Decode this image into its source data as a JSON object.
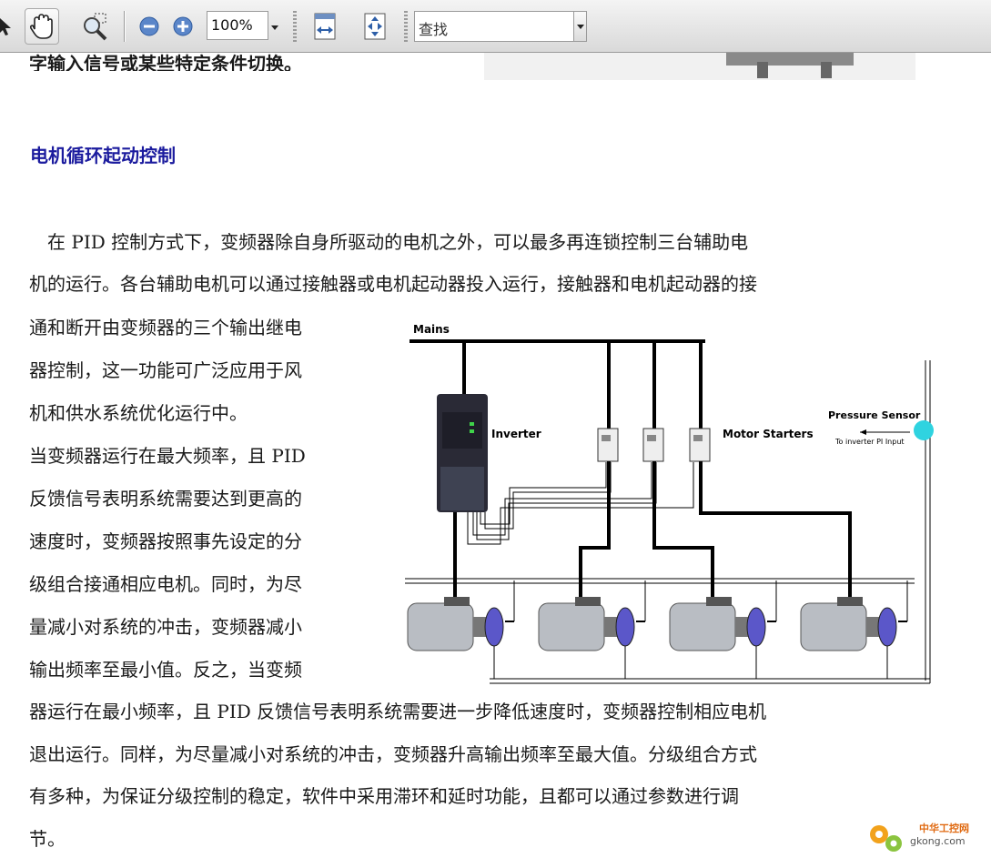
{
  "toolbar": {
    "zoom_value": "100%",
    "find_placeholder": "查找",
    "icons": [
      "select-arrow-icon",
      "hand-icon",
      "zoom-marquee-icon",
      "zoom-out-icon",
      "zoom-in-icon",
      "fit-width-icon",
      "fit-page-icon"
    ]
  },
  "document": {
    "cut_top_line": "字输入信号或某些特定条件切换。",
    "section_heading": "电机循环起动控制",
    "lines": [
      "　在 PID 控制方式下，变频器除自身所驱动的电机之外，可以最多再连锁控制三台辅助电",
      "机的运行。各台辅助电机可以通过接触器或电机起动器投入运行，接触器和电机起动器的接",
      "通和断开由变频器的三个输出继电",
      "器控制，这一功能可广泛应用于风",
      "机和供水系统优化运行中。",
      "当变频器运行在最大频率，且 PID",
      "反馈信号表明系统需要达到更高的",
      "速度时，变频器按照事先设定的分",
      "级组合接通相应电机。同时，为尽",
      "量减小对系统的冲击，变频器减小",
      "输出频率至最小值。反之，当变频",
      "器运行在最小频率，且 PID 反馈信号表明系统需要进一步降低速度时，变频器控制相应电机",
      "退出运行。同样，为尽量减小对系统的冲击，变频器升高输出频率至最大值。分级组合方式",
      "有多种，为保证分级控制的稳定，软件中采用滞环和延时功能，且都可以通过参数进行调",
      "节。"
    ]
  },
  "diagram": {
    "mains_label": "Mains",
    "inverter_label": "Inverter",
    "motor_starters_label": "Motor Starters",
    "pressure_sensor_label": "Pressure Sensor",
    "sensor_sub_label": "To inverter PI Input"
  },
  "watermark": {
    "line1": "中华工控网",
    "line2": "gkong.com"
  }
}
